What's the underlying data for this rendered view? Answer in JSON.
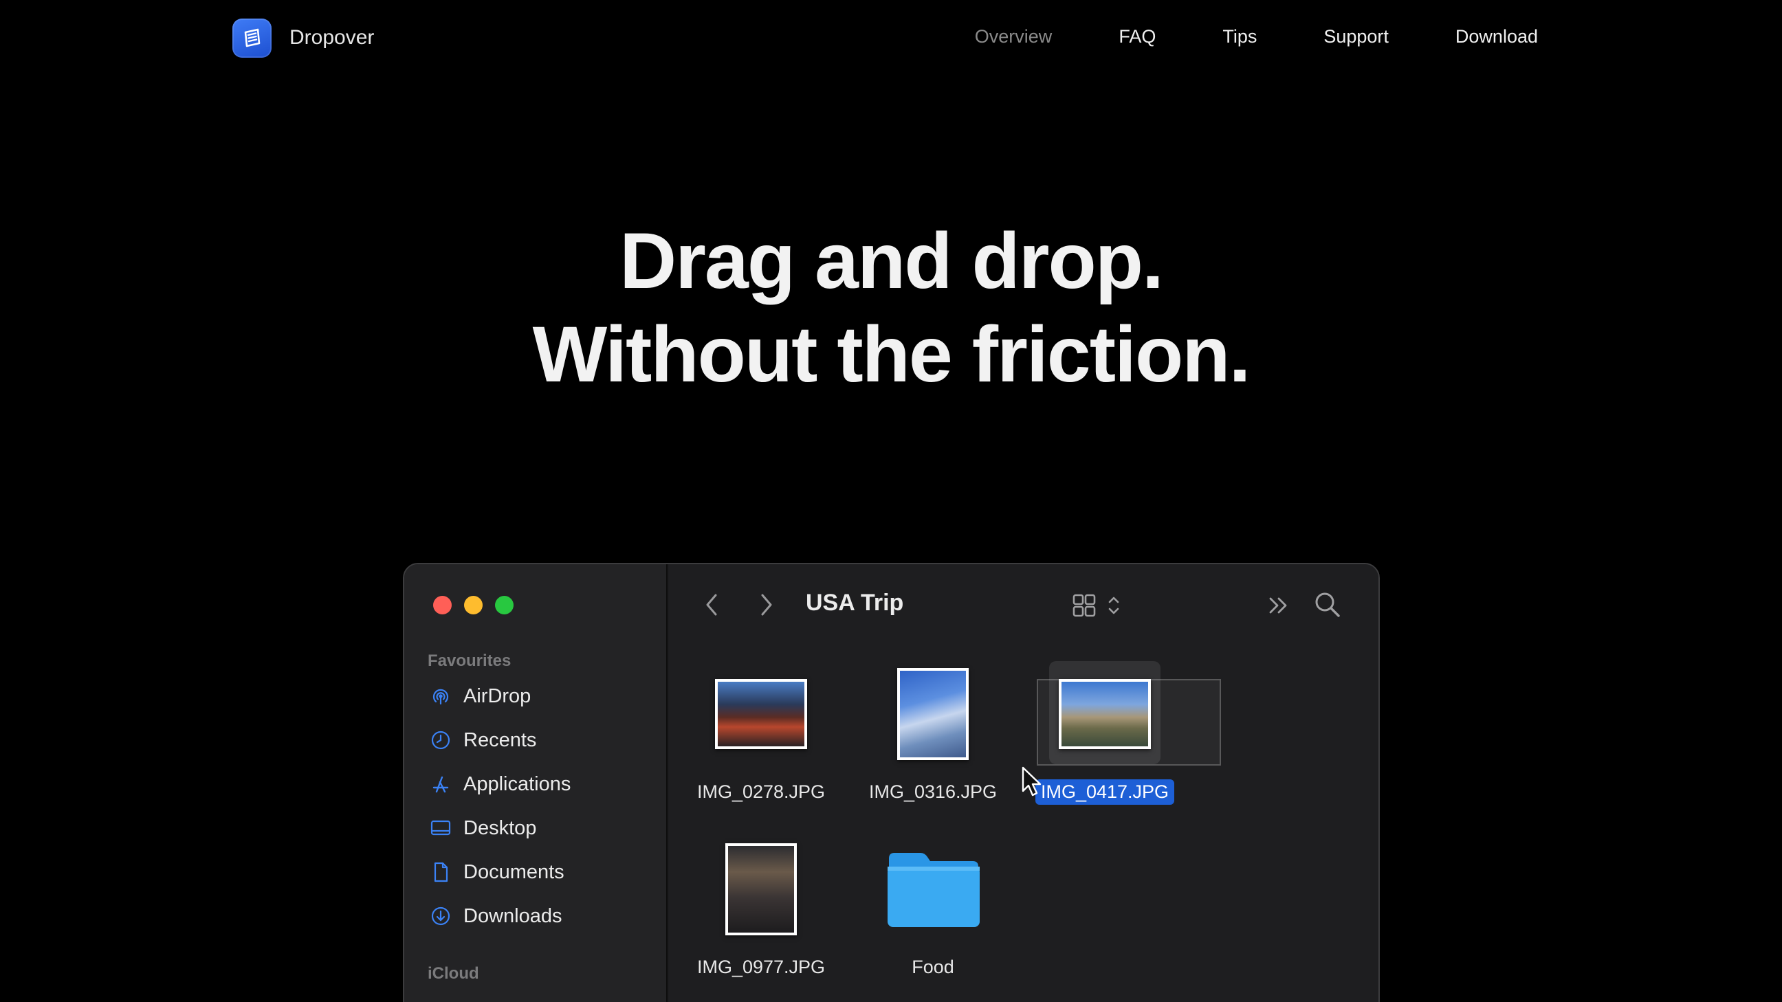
{
  "nav": {
    "brand": "Dropover",
    "links": [
      "Overview",
      "FAQ",
      "Tips",
      "Support",
      "Download"
    ],
    "active_link": "Overview"
  },
  "hero": {
    "line1": "Drag and drop.",
    "line2": "Without the friction."
  },
  "finder": {
    "title": "USA Trip",
    "sidebar": {
      "favourites_title": "Favourites",
      "items": [
        "AirDrop",
        "Recents",
        "Applications",
        "Desktop",
        "Documents",
        "Downloads"
      ],
      "icloud_title": "iCloud"
    },
    "files": [
      {
        "name": "IMG_0278.JPG",
        "kind": "photo"
      },
      {
        "name": "IMG_0316.JPG",
        "kind": "photo"
      },
      {
        "name": "IMG_0417.JPG",
        "kind": "photo",
        "selected": true
      },
      {
        "name": "IMG_0977.JPG",
        "kind": "photo"
      },
      {
        "name": "Food",
        "kind": "folder"
      }
    ]
  },
  "colors": {
    "background": "#000000",
    "accent_blue": "#1d5fd6",
    "traffic_red": "#ff5f57",
    "traffic_yellow": "#febc2e",
    "traffic_green": "#28c840",
    "sidebar_icon_blue": "#3b82f6"
  },
  "icons": {
    "brand": "dropover-app-icon",
    "sidebar": [
      "airdrop-icon",
      "clock-icon",
      "applications-icon",
      "desktop-icon",
      "document-icon",
      "download-icon"
    ],
    "toolbar": [
      "back-chevron-icon",
      "forward-chevron-icon",
      "grid-view-icon",
      "more-chevron-icon",
      "search-icon"
    ]
  }
}
